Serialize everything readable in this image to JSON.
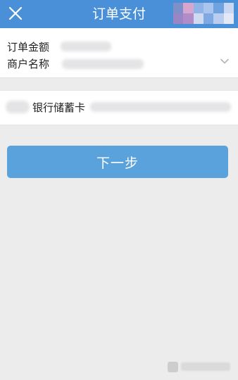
{
  "header": {
    "title": "订单支付",
    "close_icon": "close-icon",
    "bg_color": "#4a90d9"
  },
  "order": {
    "amount_label": "订单金额",
    "merchant_label": "商户名称",
    "expand_icon": "chevron-down-icon"
  },
  "payment": {
    "card_label": "银行储蓄卡"
  },
  "next_button": {
    "label": "下一步",
    "color": "#5aa2db"
  }
}
